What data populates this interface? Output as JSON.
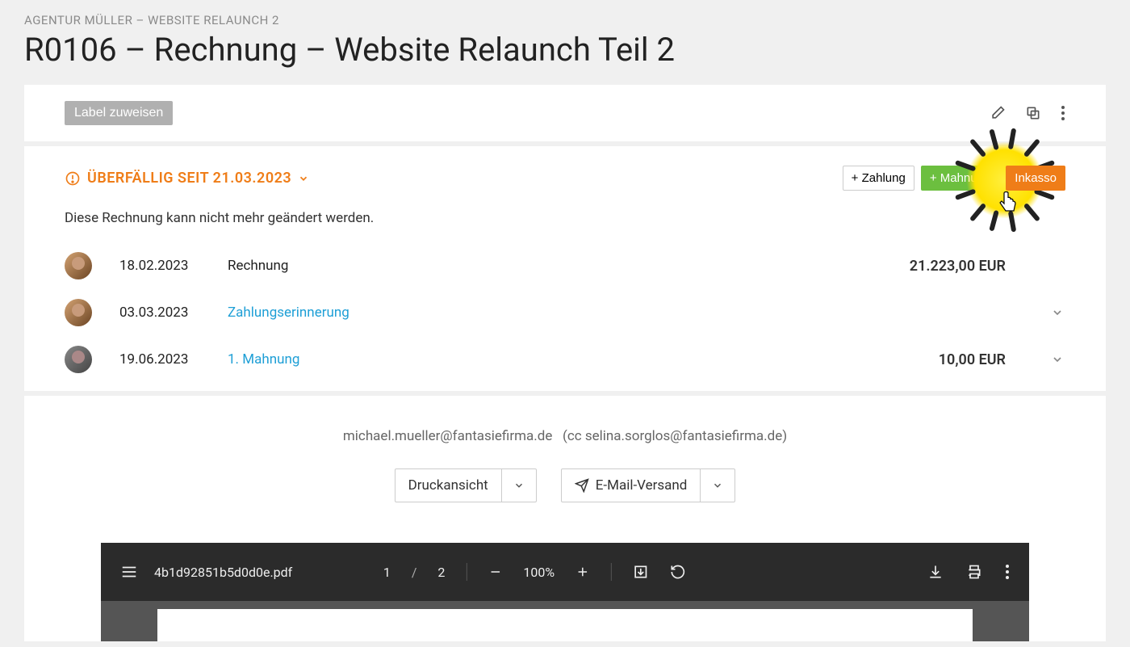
{
  "breadcrumb": "AGENTUR MÜLLER – WEBSITE RELAUNCH 2",
  "page_title": "R0106 – Rechnung – Website Relaunch Teil 2",
  "label_assign": "Label zuweisen",
  "overdue_text": "ÜBERFÄLLIG SEIT 21.03.2023",
  "actions": {
    "zahlung": "+ Zahlung",
    "mahnung": "+ Mahnung",
    "inkasso": "Inkasso"
  },
  "locked_note": "Diese Rechnung kann nicht mehr geändert werden.",
  "history": [
    {
      "date": "18.02.2023",
      "label": "Rechnung",
      "link": false,
      "amount": "21.223,00 EUR",
      "expand": false
    },
    {
      "date": "03.03.2023",
      "label": "Zahlungserinnerung",
      "link": true,
      "amount": "",
      "expand": true
    },
    {
      "date": "19.06.2023",
      "label": "1. Mahnung",
      "link": true,
      "amount": "10,00 EUR",
      "expand": true
    }
  ],
  "email_to": "michael.mueller@fantasiefirma.de",
  "email_cc": "(cc selina.sorglos@fantasiefirma.de)",
  "print_btn": "Druckansicht",
  "send_btn": "E-Mail-Versand",
  "pdf": {
    "filename": "4b1d92851b5d0d0e.pdf",
    "page_current": "1",
    "page_sep": "/",
    "page_total": "2",
    "zoom": "100%"
  }
}
